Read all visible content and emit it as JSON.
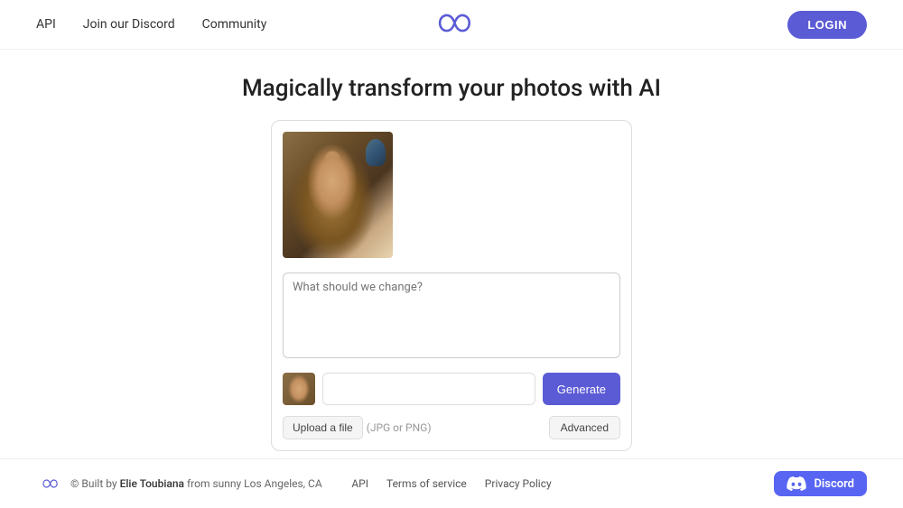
{
  "header": {
    "nav": {
      "api_label": "API",
      "discord_label": "Join our Discord",
      "community_label": "Community",
      "login_label": "LOGIN"
    }
  },
  "main": {
    "headline": "Magically transform your photos with AI",
    "prompt_placeholder": "What should we change?",
    "generate_label": "Generate",
    "upload_label": "Upload a file",
    "upload_hint": "(JPG or PNG)",
    "advanced_label": "Advanced"
  },
  "footer": {
    "credit": "© Built by ",
    "author": "Elie Toubiana",
    "location": " from sunny Los Angeles, CA",
    "api_label": "API",
    "terms_label": "Terms of service",
    "privacy_label": "Privacy Policy",
    "discord_label": "Discord"
  },
  "colors": {
    "accent": "#5b5bd6",
    "discord_blue": "#5865f2"
  }
}
